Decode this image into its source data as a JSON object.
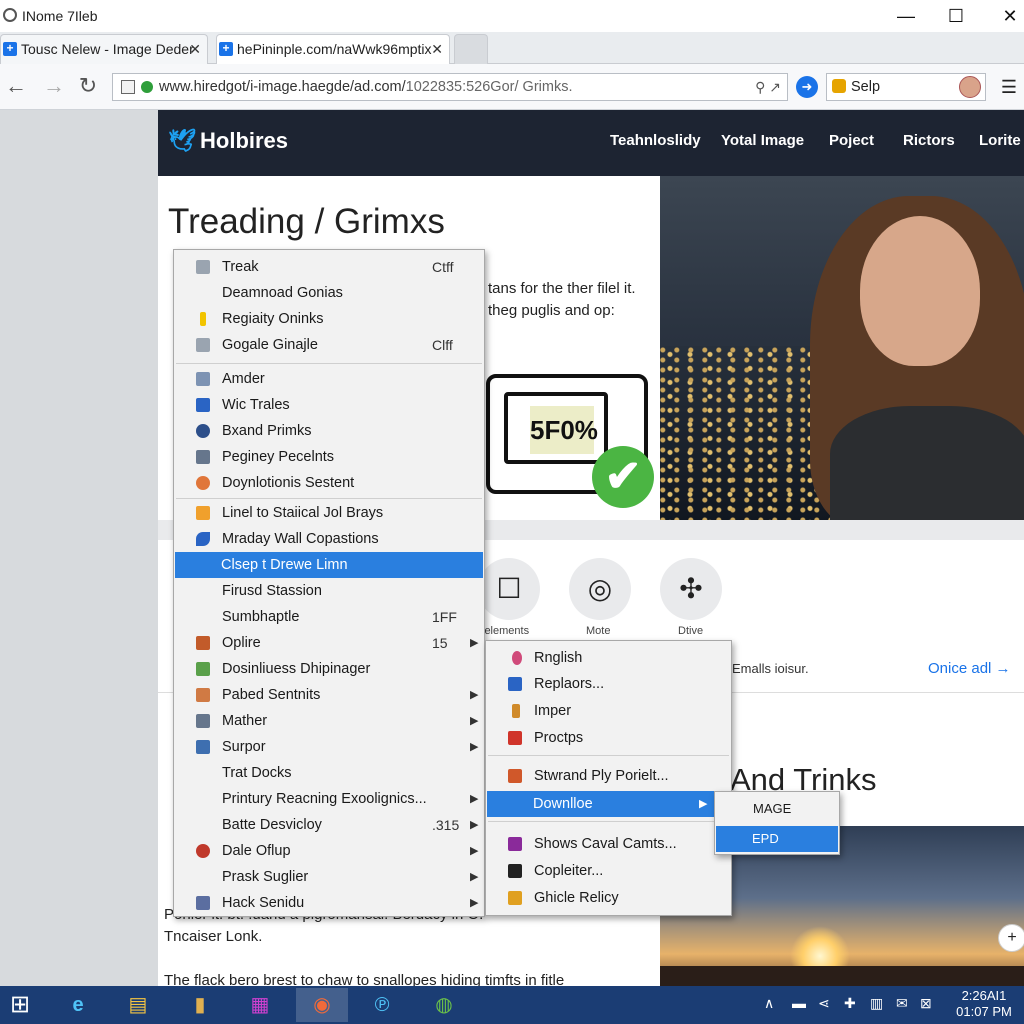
{
  "window": {
    "title": "INome 7Ileb",
    "minimize": "—",
    "maximize": "☐",
    "close": "✕"
  },
  "tabs": [
    {
      "label": "Tousc Nelew - Image Deder",
      "close": "✕"
    },
    {
      "label": "hePininple.com/naWwk96mptix",
      "close": "✕"
    }
  ],
  "toolbar": {
    "back": "←",
    "forward": "→",
    "reload": "↻",
    "url_main": "www.hiredgot/i-image.haegde/ad.com/",
    "url_rest": "1022835:526Gor/ Grimks.",
    "url_icons": "⚲ ↗",
    "search_text": "Selp",
    "menu": "☰"
  },
  "header": {
    "logo": "Holbires",
    "nav": [
      "Teahnloslidy",
      "Yotal Image",
      "Poject",
      "Rictors",
      "Lorite"
    ]
  },
  "hero": {
    "title": "Treading / Grimxs",
    "text_line1": "tans for the ther filel it.",
    "text_line2": "theg puglis and op:",
    "badge_value": "5F0%",
    "check": "✔"
  },
  "features": [
    {
      "label": "lelements",
      "icon": "☐"
    },
    {
      "label": "Mote",
      "icon": "◎"
    },
    {
      "label": "Dtive",
      "icon": "✣"
    }
  ],
  "emails_text": "Emalls ioisur.",
  "more_link": "Onice adl →",
  "tricks_title": "And Trinks",
  "bottom": {
    "line1": "Ponier it. bt. .uand a pigromansal. Berdacy in O.",
    "line2": "Tncaiser Lonk.",
    "line3": "The flack bero brest to chaw to snallopes hiding timfts in fitle"
  },
  "context_menu": {
    "items": [
      {
        "label": "Treak",
        "shortcut": "Ctff",
        "icon_color": "#9aa4b0"
      },
      {
        "label": "Deamnoad Gonias",
        "shortcut": "",
        "icon_color": ""
      },
      {
        "label": "Regiaity Oninks",
        "shortcut": "",
        "icon_color": "#f2c400"
      },
      {
        "label": "Gogale Ginajle",
        "shortcut": "Clff",
        "icon_color": "#9aa4b0"
      },
      {
        "label": "Amder",
        "shortcut": "",
        "icon_color": "#7d93b3"
      },
      {
        "label": "Wic Trales",
        "shortcut": "",
        "icon_color": "#2a64c4"
      },
      {
        "label": "Bxand Primks",
        "shortcut": "",
        "icon_color": "#2d4f8a"
      },
      {
        "label": "Peginey Pecelnts",
        "shortcut": "",
        "icon_color": "#66768c"
      },
      {
        "label": "Doynlotionis Sestent",
        "shortcut": "",
        "icon_color": "#e0763a"
      },
      {
        "label": "Linel to Staiical Jol Brays",
        "shortcut": "",
        "icon_color": "#f0a02c"
      },
      {
        "label": "Mraday Wall Copastions",
        "shortcut": "",
        "icon_color": "#2a64c4"
      },
      {
        "label": "Clsep t Drewe Limn",
        "shortcut": "",
        "icon_color": ""
      },
      {
        "label": "Firusd Stassion",
        "shortcut": "",
        "icon_color": ""
      },
      {
        "label": "Sumbhaptle",
        "shortcut": "1FF",
        "icon_color": ""
      },
      {
        "label": "Oplire",
        "shortcut": "15",
        "icon_color": "#c25b2a"
      },
      {
        "label": "Dosinliuess Dhipinager",
        "shortcut": "",
        "icon_color": "#5aa04a"
      },
      {
        "label": "Pabed Sentnits",
        "shortcut": "",
        "icon_color": "#d07a44"
      },
      {
        "label": "Mather",
        "shortcut": "",
        "icon_color": "#66768c"
      },
      {
        "label": "Surpor",
        "shortcut": "",
        "icon_color": "#3e6fb0"
      },
      {
        "label": "Trat Docks",
        "shortcut": "",
        "icon_color": ""
      },
      {
        "label": "Printury Reacning Exoolignics...",
        "shortcut": "",
        "icon_color": ""
      },
      {
        "label": "Batte Desvicloy",
        "shortcut": ".315",
        "icon_color": ""
      },
      {
        "label": "Dale Oflup",
        "shortcut": "",
        "icon_color": "#c0392b"
      },
      {
        "label": "Prask Suglier",
        "shortcut": "",
        "icon_color": ""
      },
      {
        "label": "Hack Senidu",
        "shortcut": "",
        "icon_color": "#5b6ea0"
      }
    ]
  },
  "submenu": {
    "items": [
      {
        "label": "Rnglish",
        "icon_color": "#d04a7a"
      },
      {
        "label": "Replaors...",
        "icon_color": "#2a64c4"
      },
      {
        "label": "Imper",
        "icon_color": "#d08a2a"
      },
      {
        "label": "Proctps",
        "icon_color": "#d0342a"
      },
      {
        "label": "Stwrand Ply Porielt...",
        "icon_color": "#d0582a"
      },
      {
        "label": "Downlloe",
        "icon_color": ""
      },
      {
        "label": "Shows Caval Camts...",
        "icon_color": "#8a2a9a"
      },
      {
        "label": "Copleiter...",
        "icon_color": "#222222"
      },
      {
        "label": "Ghicle Relicy",
        "icon_color": "#e0a020"
      }
    ]
  },
  "submenu2": {
    "items": [
      "MAGE",
      "EPD"
    ]
  },
  "taskbar": {
    "start": "⊞",
    "apps": [
      "e",
      "▤",
      "▮",
      "▦",
      "◉",
      "℗",
      "◍"
    ],
    "tray": [
      "∧",
      "▬",
      "⋖",
      "✚",
      "▥",
      "✉",
      "⊠"
    ],
    "clock_time": "2:26AI1",
    "clock_date": "01:07 PM"
  },
  "colors": {
    "accent": "#2a7fdf",
    "header_bg": "#1d2432",
    "taskbar": "#1b3d74"
  }
}
